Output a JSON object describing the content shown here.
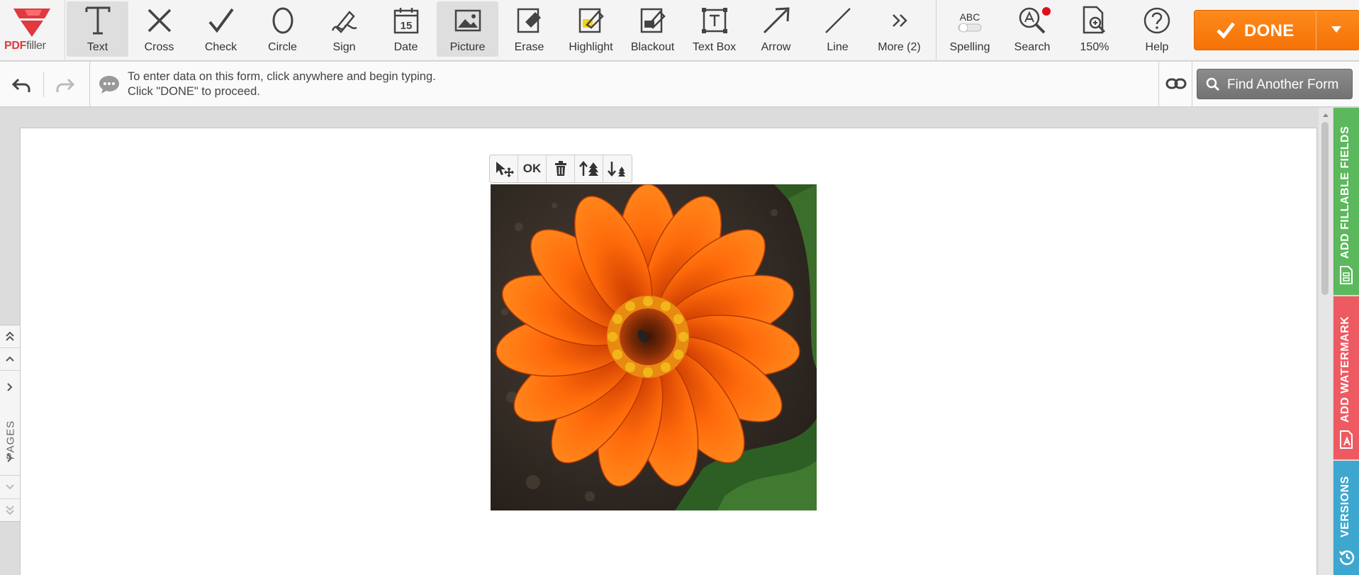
{
  "logo": {
    "part1": "PDF",
    "part2": "filler"
  },
  "tools": [
    {
      "id": "text",
      "label": "Text",
      "icon": "text-icon",
      "active": true
    },
    {
      "id": "cross",
      "label": "Cross",
      "icon": "cross-icon"
    },
    {
      "id": "check",
      "label": "Check",
      "icon": "check-icon"
    },
    {
      "id": "circle",
      "label": "Circle",
      "icon": "circle-icon"
    },
    {
      "id": "sign",
      "label": "Sign",
      "icon": "sign-icon"
    },
    {
      "id": "date",
      "label": "Date",
      "icon": "calendar-icon",
      "day": "15"
    },
    {
      "id": "picture",
      "label": "Picture",
      "icon": "picture-icon",
      "active": true
    },
    {
      "id": "erase",
      "label": "Erase",
      "icon": "eraser-icon"
    },
    {
      "id": "highlight",
      "label": "Highlight",
      "icon": "highlight-icon"
    },
    {
      "id": "blackout",
      "label": "Blackout",
      "icon": "blackout-icon"
    },
    {
      "id": "textbox",
      "label": "Text Box",
      "icon": "textbox-icon"
    },
    {
      "id": "arrow",
      "label": "Arrow",
      "icon": "arrow-icon"
    },
    {
      "id": "line",
      "label": "Line",
      "icon": "line-icon"
    },
    {
      "id": "more",
      "label": "More (2)",
      "icon": "double-chevron-right-icon"
    }
  ],
  "tools2": [
    {
      "id": "spelling",
      "label": "Spelling",
      "icon": "spelling-toggle-icon",
      "badge": "ABC"
    },
    {
      "id": "search",
      "label": "Search",
      "icon": "search-icon"
    },
    {
      "id": "zoom",
      "label": "150%",
      "icon": "zoom-icon"
    },
    {
      "id": "help",
      "label": "Help",
      "icon": "help-icon"
    }
  ],
  "done": {
    "label": "DONE"
  },
  "info": {
    "line1": "To enter data on this form, click anywhere and begin typing.",
    "line2": "Click \"DONE\" to proceed."
  },
  "find_form": {
    "label": "Find Another Form"
  },
  "image_toolbar": {
    "ok_label": "OK"
  },
  "pages_nav": {
    "label": "PAGES"
  },
  "right_tabs": {
    "fields": "ADD FILLABLE FIELDS",
    "watermark": "ADD WATERMARK",
    "versions": "VERSIONS"
  },
  "colors": {
    "done": "#f47206",
    "fields_tab": "#5cb85c",
    "watermark_tab": "#ee5a61",
    "versions_tab": "#3ea7cf",
    "search_badge": "#e0101a"
  }
}
